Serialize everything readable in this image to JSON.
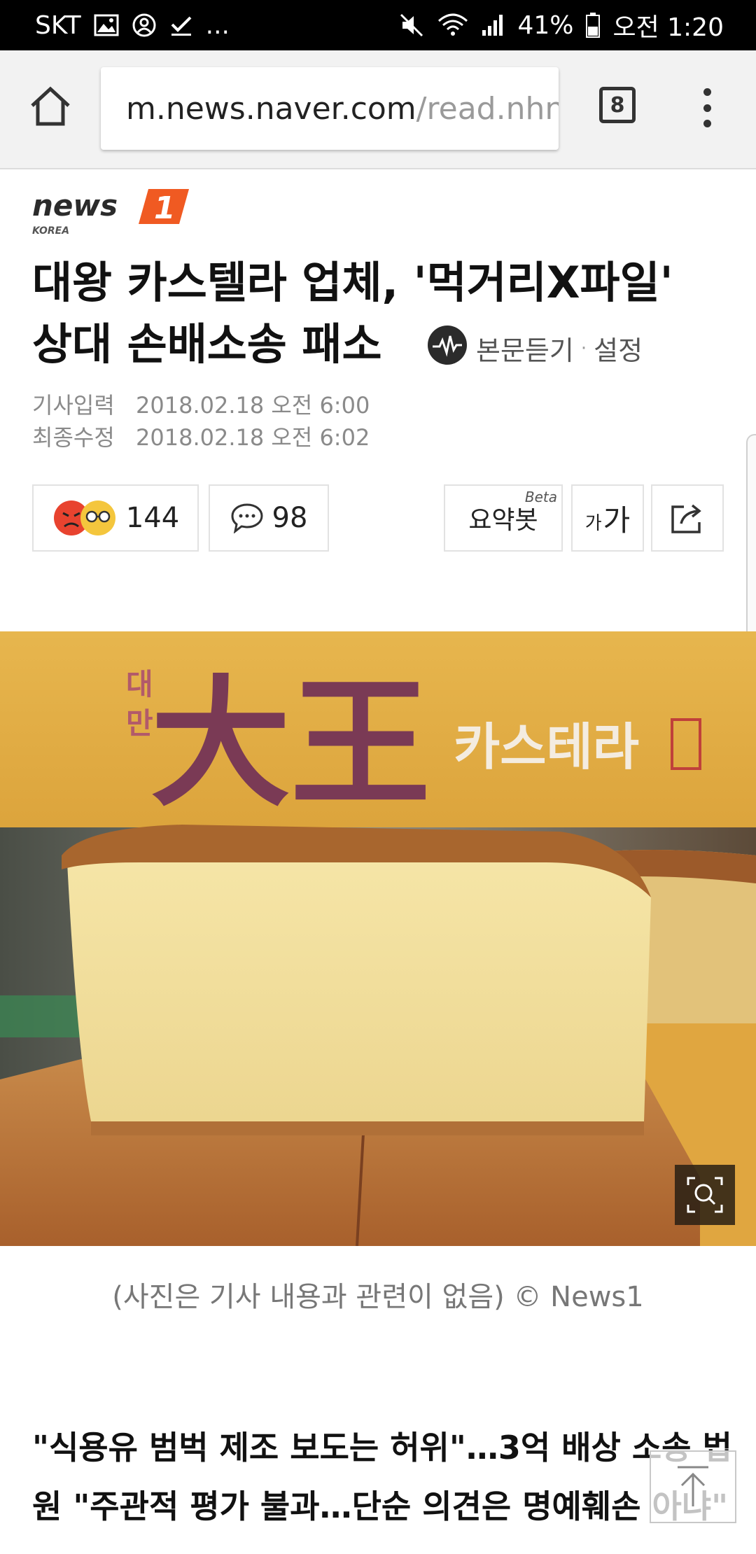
{
  "status_bar": {
    "carrier": "SKT",
    "overflow": "...",
    "battery": "41%",
    "time": "오전 1:20",
    "icons": [
      "image-icon",
      "account-icon",
      "check-icon",
      "mute-icon",
      "wifi-icon",
      "signal-icon",
      "battery-icon"
    ]
  },
  "browser": {
    "url_host": "m.news.naver.com",
    "url_path": "/read.nhn",
    "tab_count": "8"
  },
  "article": {
    "logo_text": "news",
    "logo_num": "1",
    "logo_sub": "KOREA",
    "headline_line1": "대왕 카스텔라 업체, '먹거리X파일'",
    "headline_line2": "상대 손배소송 패소",
    "listen_label": "본문듣기",
    "listen_sep": "·",
    "settings_label": "설정",
    "published_label": "기사입력",
    "published_value": "2018.02.18 오전 6:00",
    "modified_label": "최종수정",
    "modified_value": "2018.02.18 오전 6:02",
    "reaction_count": "144",
    "comment_count": "98",
    "summary_label": "요약봇",
    "summary_badge": "Beta",
    "font_label_small": "가",
    "font_label_big": "가",
    "caption": "(사진은 기사 내용과 관련이 없음) © News1",
    "subhead": "\"식용유 범벅 제조 보도는 허위\"…3억 배상 소송 법원 \"주관적 평가 불과…단순 의견은 명예훼손 아냐\""
  },
  "photo": {
    "sign_small": "대\n만",
    "sign_big": "大王",
    "sign_text": "카스테라",
    "sign_stamp": "단수이"
  },
  "colors": {
    "accent_orange": "#f05a22",
    "sign_purple": "#7a3a55"
  }
}
